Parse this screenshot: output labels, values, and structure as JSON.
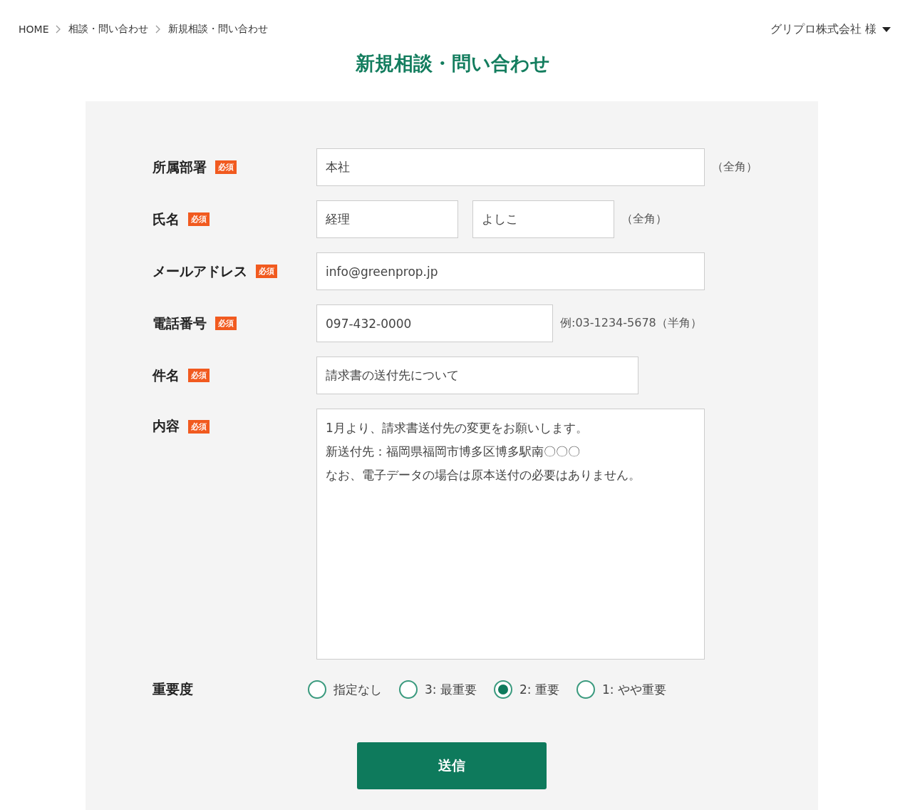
{
  "breadcrumb": [
    "HOME",
    "相談・問い合わせ",
    "新規相談・問い合わせ"
  ],
  "user_menu": {
    "label": "グリプロ株式会社 様"
  },
  "title": "新規相談・問い合わせ",
  "fields": [
    {
      "kind": "text",
      "label": "所属部署",
      "badge": "必須",
      "values": [
        "本社"
      ],
      "hint": "（全角）"
    },
    {
      "kind": "pair",
      "label": "氏名",
      "badge": "必須",
      "values": [
        "経理",
        "よしこ"
      ],
      "hint": "（全角）"
    },
    {
      "kind": "text",
      "label": "メールアドレス",
      "badge": "必須",
      "values": [
        "info@greenprop.jp"
      ]
    },
    {
      "kind": "text",
      "label": "電話番号",
      "badge": "必須",
      "values": [
        "097-432-0000"
      ],
      "hint": "例:03-1234-5678（半角）"
    },
    {
      "kind": "text",
      "label": "件名",
      "badge": "必須",
      "values": [
        "請求書の送付先について"
      ]
    },
    {
      "kind": "area",
      "label": "内容",
      "badge": "必須",
      "values": [
        "1月より、請求書送付先の変更をお願いします。",
        "新送付先：福岡県福岡市博多区博多駅南〇〇〇",
        "なお、電子データの場合は原本送付の必要はありません。"
      ]
    }
  ],
  "priority": {
    "label": "重要度",
    "options": [
      {
        "label": "指定なし",
        "selected": false
      },
      {
        "label": "3: 最重要",
        "selected": false
      },
      {
        "label": "2: 重要",
        "selected": true
      },
      {
        "label": "1: やや重要",
        "selected": false
      }
    ]
  },
  "submit": "送信"
}
